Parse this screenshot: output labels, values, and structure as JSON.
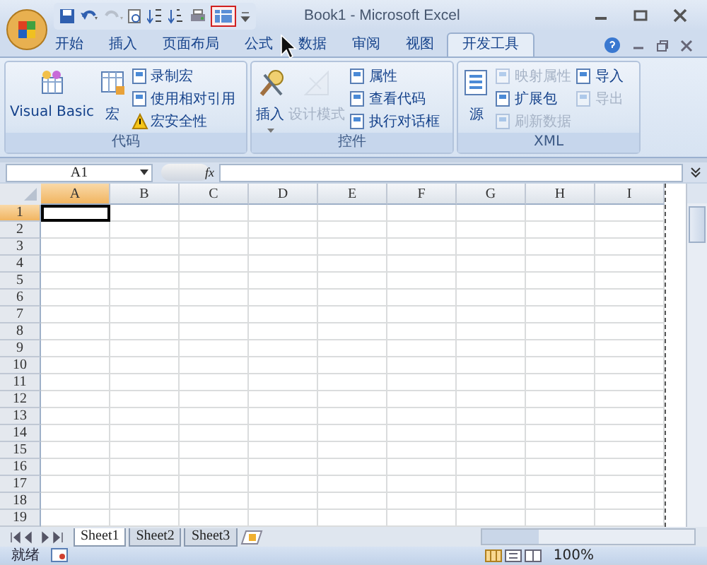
{
  "window": {
    "title": "Book1 - Microsoft Excel"
  },
  "ribbon_tabs": [
    {
      "label": "开始",
      "selected": false
    },
    {
      "label": "插入",
      "selected": false
    },
    {
      "label": "页面布局",
      "selected": false
    },
    {
      "label": "公式",
      "selected": false
    },
    {
      "label": "数据",
      "selected": false
    },
    {
      "label": "审阅",
      "selected": false
    },
    {
      "label": "视图",
      "selected": false
    },
    {
      "label": "开发工具",
      "selected": true
    }
  ],
  "groups": [
    {
      "label": "代码",
      "large": [
        {
          "label": "Visual Basic",
          "disabled": false
        },
        {
          "label": "宏",
          "disabled": false
        }
      ],
      "small": [
        {
          "label": "录制宏",
          "disabled": false
        },
        {
          "label": "使用相对引用",
          "disabled": false
        },
        {
          "label": "宏安全性",
          "disabled": false
        }
      ]
    },
    {
      "label": "控件",
      "large": [
        {
          "label": "插入",
          "disabled": false
        },
        {
          "label": "设计模式",
          "disabled": true
        }
      ],
      "small": [
        {
          "label": "属性",
          "disabled": false
        },
        {
          "label": "查看代码",
          "disabled": false
        },
        {
          "label": "执行对话框",
          "disabled": false
        }
      ]
    },
    {
      "label": "XML",
      "large": [
        {
          "label": "源",
          "disabled": false
        }
      ],
      "small": [
        {
          "label": "映射属性",
          "disabled": true
        },
        {
          "label": "扩展包",
          "disabled": false
        },
        {
          "label": "刷新数据",
          "disabled": true
        },
        {
          "label": "导入",
          "disabled": false
        },
        {
          "label": "导出",
          "disabled": true
        }
      ]
    }
  ],
  "formula_bar": {
    "name_box": "A1",
    "fx": "fx"
  },
  "columns": [
    {
      "label": "A",
      "selected": true
    },
    {
      "label": "B",
      "selected": false
    },
    {
      "label": "C",
      "selected": false
    },
    {
      "label": "D",
      "selected": false
    },
    {
      "label": "E",
      "selected": false
    },
    {
      "label": "F",
      "selected": false
    },
    {
      "label": "G",
      "selected": false
    },
    {
      "label": "H",
      "selected": false
    },
    {
      "label": "I",
      "selected": false
    }
  ],
  "rows": [
    {
      "label": "1",
      "selected": true
    },
    {
      "label": "2",
      "selected": false
    },
    {
      "label": "3",
      "selected": false
    },
    {
      "label": "4",
      "selected": false
    },
    {
      "label": "5",
      "selected": false
    },
    {
      "label": "6",
      "selected": false
    },
    {
      "label": "7",
      "selected": false
    },
    {
      "label": "8",
      "selected": false
    },
    {
      "label": "9",
      "selected": false
    },
    {
      "label": "10",
      "selected": false
    },
    {
      "label": "11",
      "selected": false
    },
    {
      "label": "12",
      "selected": false
    },
    {
      "label": "13",
      "selected": false
    },
    {
      "label": "14",
      "selected": false
    },
    {
      "label": "15",
      "selected": false
    },
    {
      "label": "16",
      "selected": false
    },
    {
      "label": "17",
      "selected": false
    },
    {
      "label": "18",
      "selected": false
    },
    {
      "label": "19",
      "selected": false
    }
  ],
  "sheet_tabs": [
    {
      "label": "Sheet1",
      "selected": true
    },
    {
      "label": "Sheet2",
      "selected": false
    },
    {
      "label": "Sheet3",
      "selected": false
    }
  ],
  "status_bar": {
    "status": "就绪",
    "zoom": "100%"
  }
}
